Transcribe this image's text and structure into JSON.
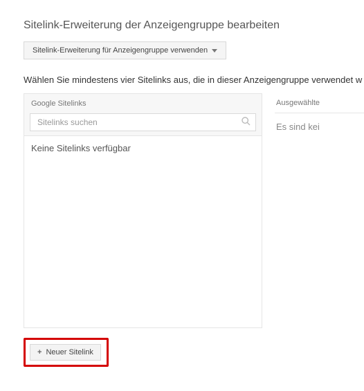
{
  "title": "Sitelink-Erweiterung der Anzeigengruppe bearbeiten",
  "dropdown": {
    "label": "Sitelink-Erweiterung für Anzeigengruppe verwenden"
  },
  "instruction": "Wählen Sie mindestens vier Sitelinks aus, die in dieser Anzeigengruppe verwendet w",
  "left_panel": {
    "header": "Google Sitelinks",
    "search_placeholder": "Sitelinks suchen",
    "empty": "Keine Sitelinks verfügbar"
  },
  "right_panel": {
    "header": "Ausgewählte",
    "empty": "Es sind kei"
  },
  "new_button": {
    "label": "Neuer Sitelink"
  }
}
